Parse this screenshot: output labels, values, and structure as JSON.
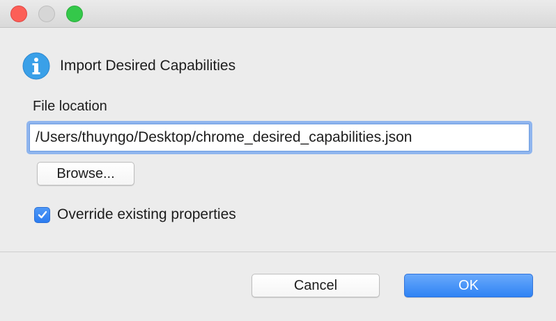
{
  "window": {
    "traffic_lights": [
      "close",
      "minimize",
      "zoom"
    ],
    "colors": {
      "close": "#fc5f57",
      "minimize": "#d6d6d6",
      "zoom": "#34c84a"
    }
  },
  "dialog": {
    "icon": "info-icon",
    "title": "Import Desired Capabilities",
    "file_label": "File location",
    "file_path": "/Users/thuyngo/Desktop/chrome_desired_capabilities.json",
    "browse_label": "Browse...",
    "override_label": "Override existing properties",
    "override_checked": true
  },
  "footer": {
    "cancel_label": "Cancel",
    "ok_label": "OK"
  },
  "colors": {
    "accent": "#2f83f4",
    "focus_ring": "#8fb5ee",
    "info_icon": "#3aa0e8"
  }
}
